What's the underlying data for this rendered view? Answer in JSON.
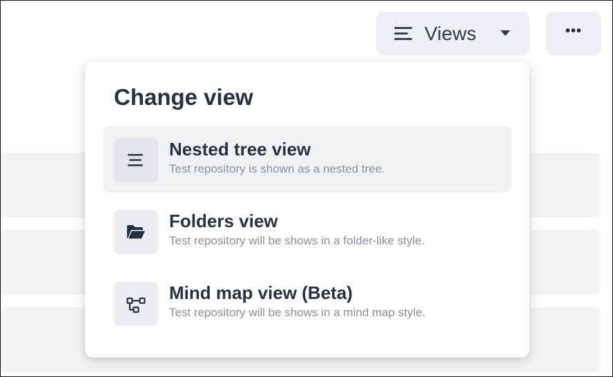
{
  "toolbar": {
    "views_label": "Views",
    "more_label": "•••"
  },
  "dropdown": {
    "title": "Change view",
    "options": [
      {
        "title": "Nested tree view",
        "description": "Test repository is shown as a nested tree.",
        "icon": "menu-lines-icon",
        "active": true
      },
      {
        "title": "Folders view",
        "description": "Test repository will be shows in a folder-like style.",
        "icon": "folder-open-icon",
        "active": false
      },
      {
        "title": "Mind map view (Beta)",
        "description": "Test repository will be shows in a mind map style.",
        "icon": "mind-map-icon",
        "active": false
      }
    ]
  },
  "colors": {
    "text_primary": "#263244",
    "text_secondary": "#8a919c",
    "button_bg": "#eef0f3",
    "active_option_bg": "#f1f2f4"
  }
}
